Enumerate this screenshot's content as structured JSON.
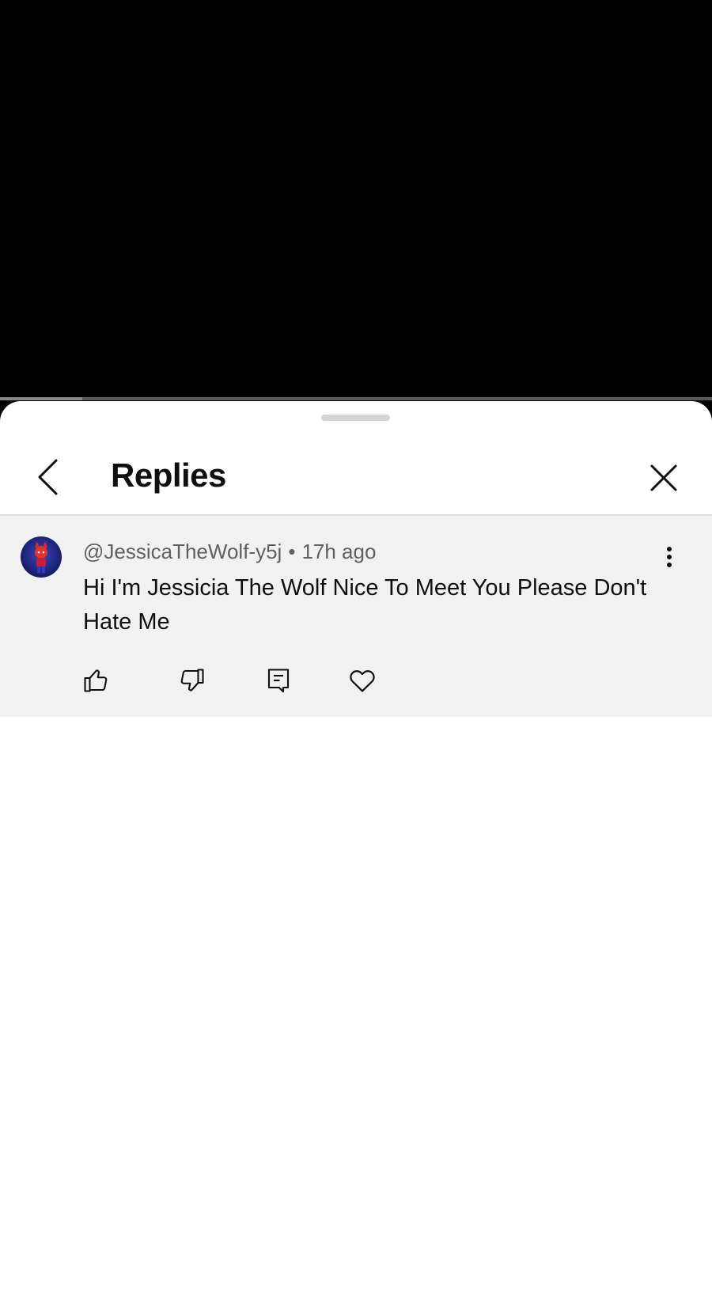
{
  "video": {
    "progress_fraction": 0.115
  },
  "header": {
    "title": "Replies",
    "back_icon": "chevron-left-icon",
    "close_icon": "close-icon"
  },
  "comment": {
    "author": "@JessicaTheWolf-y5j",
    "separator": "•",
    "time": "17h ago",
    "text": "Hi I'm Jessicia The Wolf Nice To Meet You Please Don't Hate Me",
    "actions": [
      "thumbs-up-icon",
      "thumbs-down-icon",
      "reply-icon",
      "heart-icon"
    ]
  },
  "colors": {
    "sheet_bg": "#ffffff",
    "comment_bg": "#f1f1f1",
    "text_primary": "#0f0f0f",
    "text_secondary": "#606060"
  }
}
